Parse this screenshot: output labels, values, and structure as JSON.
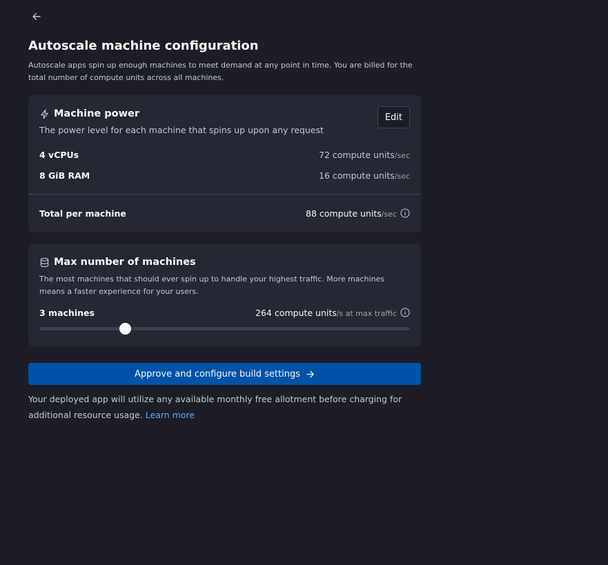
{
  "title": "Autoscale machine configuration",
  "subtitle": "Autoscale apps spin up enough machines to meet demand at any point in time. You are billed for the total number of compute units across all machines.",
  "machine_power": {
    "title": "Machine power",
    "description": "The power level for each machine that spins up upon any request",
    "edit_label": "Edit",
    "rows": [
      {
        "label": "4 vCPUs",
        "value": "72 compute units",
        "unit": "/sec"
      },
      {
        "label": "8 GiB RAM",
        "value": "16 compute units",
        "unit": "/sec"
      }
    ],
    "total": {
      "label": "Total per machine",
      "value": "88 compute units",
      "unit": "/sec"
    }
  },
  "max_machines": {
    "title": "Max number of machines",
    "description": "The most machines that should ever spin up to handle your highest traffic. More machines means a faster experience for your users.",
    "count_label": "3 machines",
    "value": "264 compute units",
    "unit": "/s at max traffic",
    "slider_position": 0.23
  },
  "primary_button": {
    "label": "Approve and configure build settings"
  },
  "footnote": {
    "text": "Your deployed app will utilize any available monthly free allotment before charging for additional resource usage.",
    "link": "Learn more"
  },
  "colors": {
    "background": "#1c1d27",
    "card": "#252733",
    "primary": "#0053a6",
    "link": "#57abff"
  },
  "icons": {
    "back": "arrow-left-icon",
    "power": "lightning-icon",
    "machines": "database-icon",
    "info": "info-icon",
    "button_arrow": "arrow-right-icon"
  }
}
